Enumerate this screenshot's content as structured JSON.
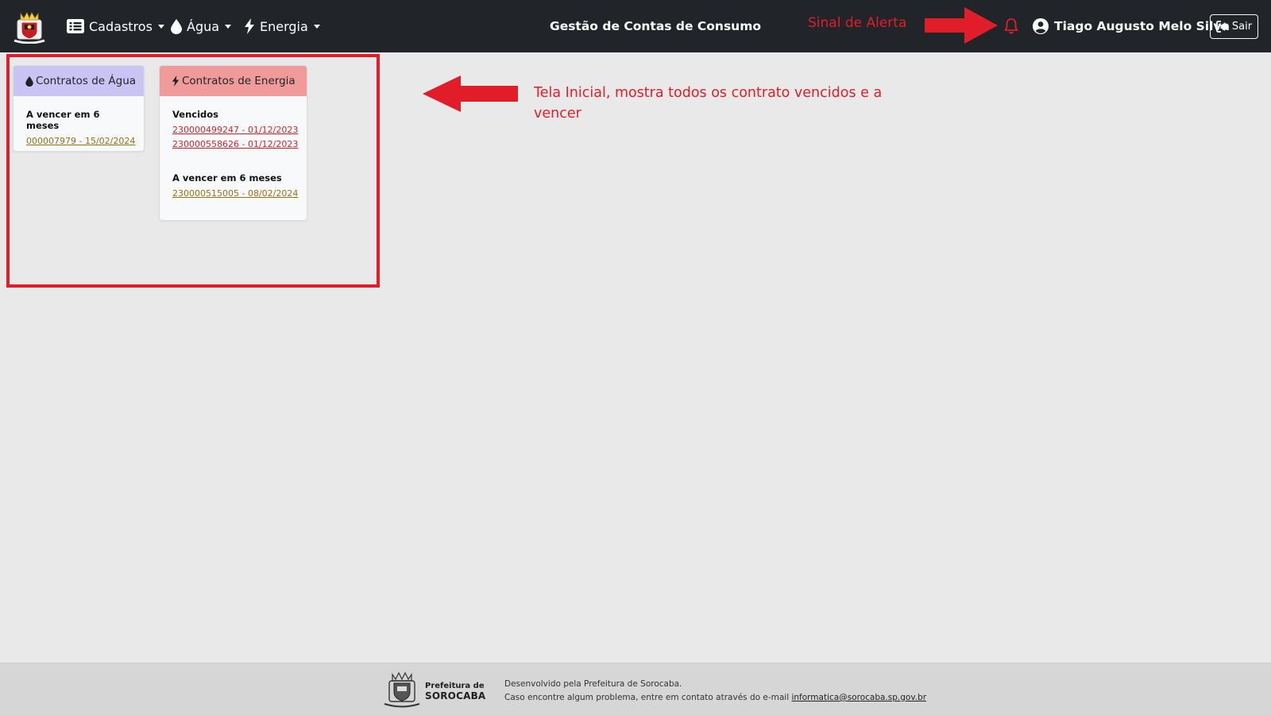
{
  "navbar": {
    "menus": [
      {
        "label": "Cadastros",
        "icon": "list-icon"
      },
      {
        "label": "Água",
        "icon": "droplet-icon"
      },
      {
        "label": "Energia",
        "icon": "bolt-icon"
      }
    ],
    "app_title": "Gestão de Contas de Consumo",
    "alert_label": "Sinal de Alerta",
    "user_name": "Tiago Augusto Melo Silva",
    "logout_label": "Sair"
  },
  "cards": {
    "water": {
      "title": "Contratos de Água",
      "header_color": "#c9c4f4",
      "sections": [
        {
          "title": "A vencer em 6 meses",
          "links": [
            "000007979 - 15/02/2024"
          ]
        }
      ]
    },
    "energy": {
      "title": "Contratos de Energia",
      "header_color": "#f19a9a",
      "sections": [
        {
          "title": "Vencidos",
          "links": [
            "230000499247 - 01/12/2023",
            "230000558626 - 01/12/2023"
          ]
        },
        {
          "title": "A vencer em 6 meses",
          "links": [
            "230000515005 - 08/02/2024"
          ]
        }
      ]
    }
  },
  "annotation": "Tela Inicial, mostra todos os contrato vencidos e a vencer",
  "footer": {
    "brand_line1": "Prefeitura de",
    "brand_line2": "SOROCABA",
    "line1": "Desenvolvido pela Prefeitura de Sorocaba.",
    "line2_prefix": "Caso encontre algum problema, entre em contato através do e-mail ",
    "email": "informatica@sorocaba.sp.gov.br"
  },
  "colors": {
    "navbar_bg": "#212529",
    "annotation_red": "#e11d2a",
    "overdue_link": "#e11d2a",
    "upcoming_link": "#9a7012",
    "page_bg": "#e9e9e9"
  }
}
